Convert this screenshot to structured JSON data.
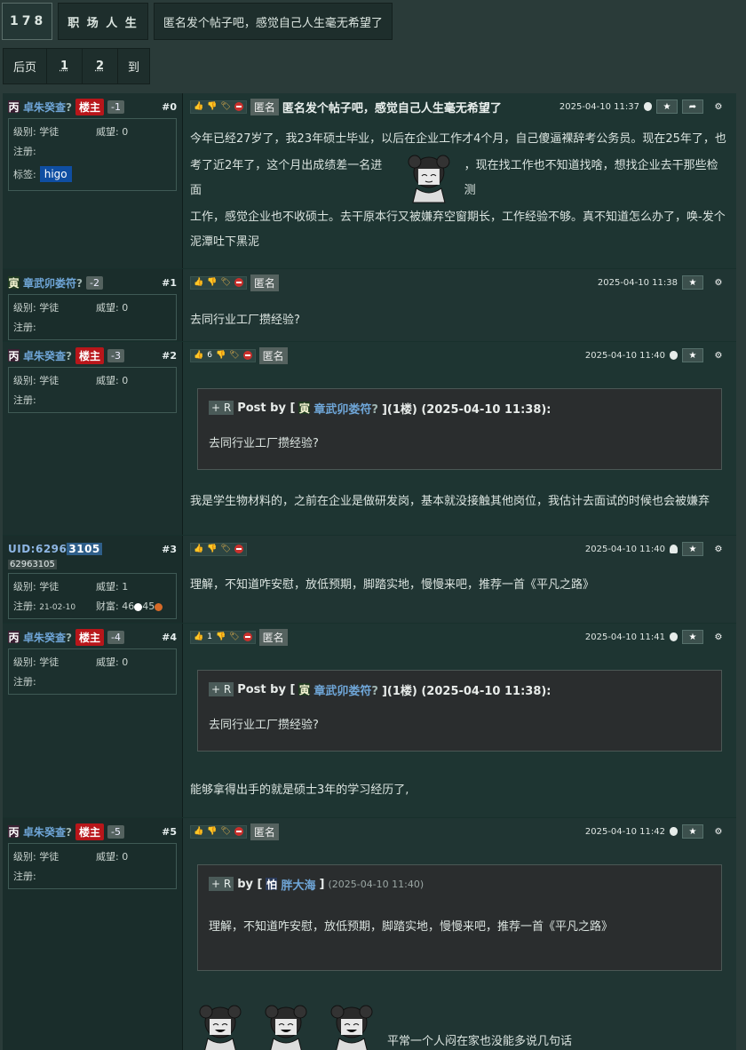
{
  "breadcrumb": {
    "count": "178",
    "forum": "职 场 人 生",
    "title": "匿名发个帖子吧，感觉自己人生毫无希望了"
  },
  "pager": {
    "prev": "后页",
    "pages": [
      "1",
      "2"
    ],
    "goto": "到"
  },
  "labels": {
    "level": "级别:",
    "prestige": "威望:",
    "reg": "注册:",
    "tags": "标签:",
    "wealth": "财富:",
    "anon": "匿名",
    "owner": "楼主",
    "post_by": "Post by [",
    "by": "by ["
  },
  "posts": [
    {
      "zi": "丙",
      "name": "卓朱癸查",
      "q": "?",
      "owner": true,
      "score": "-1",
      "floor": "#0",
      "level": "学徒",
      "prestige": "0",
      "reg": "",
      "tag": "higo",
      "up": "",
      "title": "匿名发个帖子吧，感觉自己人生毫无希望了",
      "time": "2025-04-10 11:37",
      "platform": "apple",
      "body1": "今年已经27岁了，我23年硕士毕业，以后在企业工作才4个月，自己傻逼裸辞考公务员。现在25年了，也",
      "body2": "考了近2年了，这个月出成绩差一名进面",
      "body2b": "，现在找工作也不知道找啥，想找企业去干那些检测",
      "body3": "工作，感觉企业也不收硕士。去干原本行又被嫌弃空窗期长，工作经验不够。真不知道怎么办了，唤-发个",
      "body4": "泥潭吐下黑泥"
    },
    {
      "zi": "寅",
      "name": "章武卯娄符",
      "q": "?",
      "score": "-2",
      "floor": "#1",
      "level": "学徒",
      "prestige": "0",
      "reg": "",
      "time": "2025-04-10 11:38",
      "body": "去同行业工厂攒经验?"
    },
    {
      "zi": "丙",
      "name": "卓朱癸查",
      "q": "?",
      "owner": true,
      "score": "-3",
      "floor": "#2",
      "level": "学徒",
      "prestige": "0",
      "reg": "",
      "up": "6",
      "time": "2025-04-10 11:40",
      "platform": "apple",
      "quote_zi": "寅",
      "quote_name": "章武卯娄符",
      "quote_q": "?",
      "quote_tail": "](1楼) (2025-04-10 11:38):",
      "quote_body": "去同行业工厂攒经验?",
      "body": "我是学生物材料的，之前在企业是做研发岗，基本就没接触其他岗位，我估计去面试的时候也会被嫌弃"
    },
    {
      "uid": "UID:62963105",
      "uid_pre": "UID:6296",
      "uid_hl": "3105",
      "uid_tag": "62963105",
      "floor": "#3",
      "level": "学徒",
      "prestige": "1",
      "reg": "21-02-10",
      "wealth": "46",
      "wealth2": "45",
      "time": "2025-04-10 11:40",
      "platform": "android",
      "body": "理解，不知道咋安慰，放低预期，脚踏实地，慢慢来吧，推荐一首《平凡之路》"
    },
    {
      "zi": "丙",
      "name": "卓朱癸查",
      "q": "?",
      "owner": true,
      "score": "-4",
      "floor": "#4",
      "level": "学徒",
      "prestige": "0",
      "reg": "",
      "up": "1",
      "time": "2025-04-10 11:41",
      "platform": "apple",
      "quote_zi": "寅",
      "quote_name": "章武卯娄符",
      "quote_q": "?",
      "quote_tail": "](1楼) (2025-04-10 11:38):",
      "quote_body": "去同行业工厂攒经验?",
      "body": "能够拿得出手的就是硕士3年的学习经历了,"
    },
    {
      "zi": "丙",
      "name": "卓朱癸查",
      "q": "?",
      "owner": true,
      "score": "-5",
      "floor": "#5",
      "level": "学徒",
      "prestige": "0",
      "reg": "",
      "time": "2025-04-10 11:42",
      "platform": "apple",
      "quote_zi": "怕",
      "quote_name": "胖大海",
      "quote_tail": "]",
      "quote_time": "(2025-04-10 11:40)",
      "quote_body": "理解，不知道咋安慰，放低预期，脚踏实地，慢慢来吧，推荐一首《平凡之路》",
      "body": "平常一个人闷在家也没能多说几句话"
    }
  ],
  "colors": {
    "owner_badge": "#b8161a",
    "username": "#6fa6d8",
    "tag_higo": "#0f4ea2",
    "bg": "#2a3b39"
  }
}
